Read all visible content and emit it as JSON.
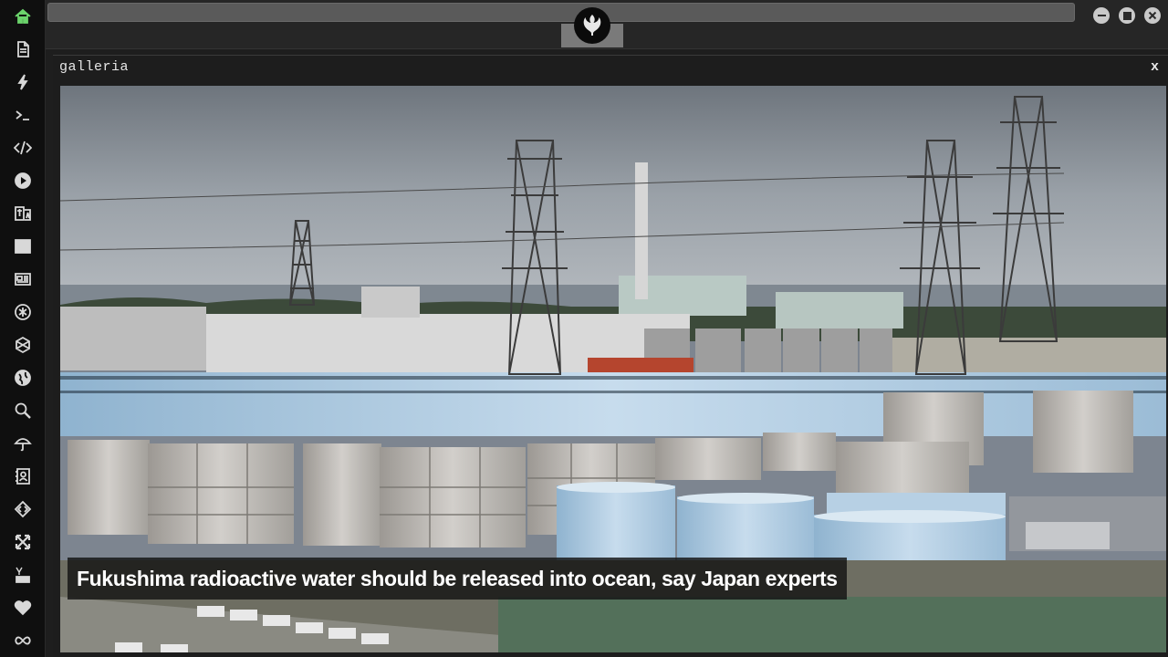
{
  "sidebar": {
    "items": [
      {
        "icon": "home-icon",
        "name": "sidebar-item-home"
      },
      {
        "icon": "document-icon",
        "name": "sidebar-item-document"
      },
      {
        "icon": "lightning-icon",
        "name": "sidebar-item-lightning"
      },
      {
        "icon": "terminal-icon",
        "name": "sidebar-item-terminal"
      },
      {
        "icon": "code-icon",
        "name": "sidebar-item-code"
      },
      {
        "icon": "play-icon",
        "name": "sidebar-item-play"
      },
      {
        "icon": "translate-icon",
        "name": "sidebar-item-translate"
      },
      {
        "icon": "image-icon",
        "name": "sidebar-item-gallery"
      },
      {
        "icon": "newspaper-icon",
        "name": "sidebar-item-news"
      },
      {
        "icon": "asterisk-icon",
        "name": "sidebar-item-asterisk"
      },
      {
        "icon": "hexagon-icon",
        "name": "sidebar-item-hexagon"
      },
      {
        "icon": "globe-icon",
        "name": "sidebar-item-globe"
      },
      {
        "icon": "search-icon",
        "name": "sidebar-item-search"
      },
      {
        "icon": "umbrella-icon",
        "name": "sidebar-item-weather"
      },
      {
        "icon": "contact-card-icon",
        "name": "sidebar-item-contacts"
      },
      {
        "icon": "diamond-code-icon",
        "name": "sidebar-item-dev"
      },
      {
        "icon": "expand-icon",
        "name": "sidebar-item-expand"
      },
      {
        "icon": "youtube-icon",
        "name": "sidebar-item-youtube"
      },
      {
        "icon": "heart-icon",
        "name": "sidebar-item-heart"
      },
      {
        "icon": "infinity-icon",
        "name": "sidebar-item-infinity"
      }
    ],
    "active_color": "#6bd36b",
    "icon_color": "#d8d8d8"
  },
  "window": {
    "logo_icon": "rebel-alliance-icon",
    "controls": [
      "minimize-icon",
      "maximize-icon",
      "close-icon"
    ]
  },
  "panel": {
    "title": "galleria",
    "close_label": "x"
  },
  "gallery": {
    "caption": "Fukushima radioactive water should be released into ocean, say Japan experts"
  }
}
